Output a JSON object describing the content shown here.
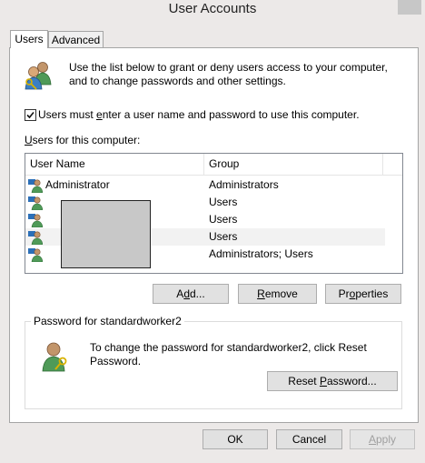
{
  "window": {
    "title": "User Accounts"
  },
  "tabs": [
    {
      "label": "Users",
      "active": true
    },
    {
      "label": "Advanced",
      "active": false
    }
  ],
  "intro": {
    "line1": "Use the list below to grant or deny users access to your computer,",
    "line2": "and to change passwords and other settings."
  },
  "require_login": {
    "checked": true,
    "pre": "Users must ",
    "mnemonic": "e",
    "post": "nter a user name and password to use this computer."
  },
  "users_list": {
    "label_mnemonic": "U",
    "label_rest": "sers for this computer:",
    "columns": [
      "User Name",
      "Group"
    ],
    "rows": [
      {
        "name": "Administrator",
        "group": "Administrators"
      },
      {
        "name": "",
        "group": "Users"
      },
      {
        "name": "",
        "group": "Users"
      },
      {
        "name": "",
        "group": "Users",
        "selected": true
      },
      {
        "name": "",
        "group": "Administrators; Users"
      }
    ]
  },
  "list_buttons": {
    "add": {
      "pre": "A",
      "mnemonic": "d",
      "post": "d..."
    },
    "remove": {
      "pre": "",
      "mnemonic": "R",
      "post": "emove"
    },
    "properties": {
      "pre": "Pr",
      "mnemonic": "o",
      "post": "perties"
    }
  },
  "password_group": {
    "title": "Password for standardworker2",
    "line1": "To change the password for standardworker2, click Reset",
    "line2": "Password.",
    "reset": {
      "pre": "Reset ",
      "mnemonic": "P",
      "post": "assword..."
    }
  },
  "footer": {
    "ok": "OK",
    "cancel": "Cancel",
    "apply": {
      "pre": "",
      "mnemonic": "A",
      "post": "pply"
    }
  },
  "icons": {
    "intro": "users-icon",
    "row": "user-icon",
    "password": "user-key-icon"
  },
  "colors": {
    "face": "#ece9e8",
    "panel": "#ffffff",
    "border": "#a5a5a5",
    "selected_row": "#f2f2f2"
  }
}
